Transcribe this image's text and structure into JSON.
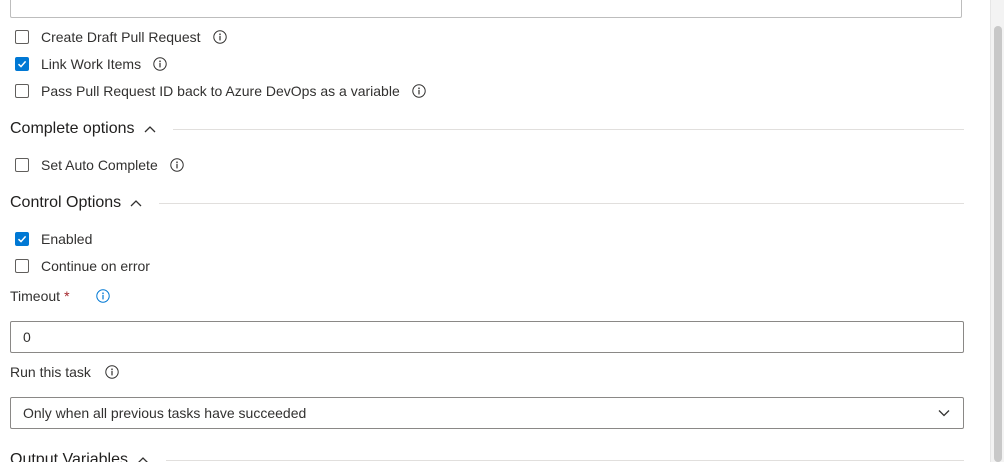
{
  "pr_options": [
    {
      "label": "Create Draft Pull Request",
      "checked": false,
      "icon": "info-icon"
    },
    {
      "label": "Link Work Items",
      "checked": true,
      "icon": "info-icon"
    },
    {
      "label": "Pass Pull Request ID back to Azure DevOps as a variable",
      "checked": false,
      "icon": "info-icon"
    }
  ],
  "complete_options": {
    "title": "Complete options",
    "expanded": true,
    "items": [
      {
        "label": "Set Auto Complete",
        "checked": false,
        "icon": "info-icon"
      }
    ]
  },
  "control_options": {
    "title": "Control Options",
    "expanded": true,
    "items": [
      {
        "label": "Enabled",
        "checked": true
      },
      {
        "label": "Continue on error",
        "checked": false
      }
    ],
    "timeout": {
      "label": "Timeout",
      "required_marker": "*",
      "value": "0"
    },
    "run_this_task": {
      "label": "Run this task",
      "selected": "Only when all previous tasks have succeeded"
    }
  },
  "output_variables": {
    "title": "Output Variables"
  },
  "colors": {
    "accent": "#0078d4",
    "required": "#a4262c",
    "info_icon_active": "#0078d4",
    "text": "#323130"
  }
}
